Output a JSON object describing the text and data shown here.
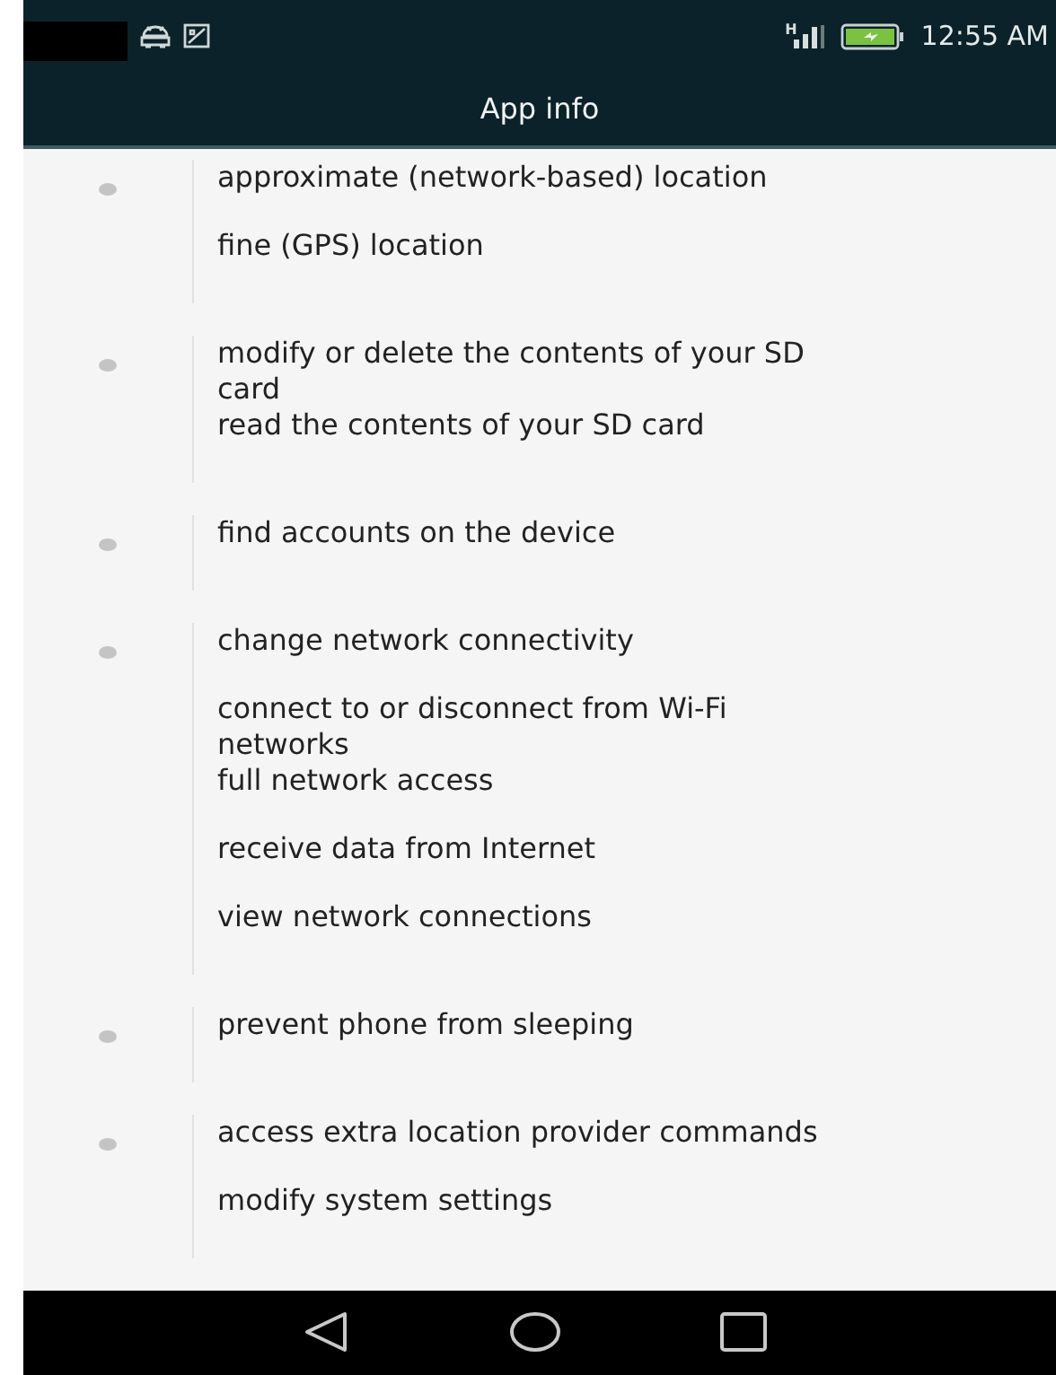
{
  "status_bar": {
    "time": "12:55 AM",
    "network_type": "H",
    "battery_charging": true
  },
  "title": "App info",
  "permission_groups": [
    {
      "items": [
        "approximate (network-based) location",
        "fine (GPS) location"
      ]
    },
    {
      "items": [
        "modify or delete the contents of your SD\ncard",
        "read the contents of your SD card"
      ]
    },
    {
      "items": [
        "find accounts on the device"
      ]
    },
    {
      "items": [
        "change network connectivity",
        "connect to or disconnect from Wi-Fi\nnetworks",
        "full network access",
        "receive data from Internet",
        "view network connections"
      ]
    },
    {
      "items": [
        "prevent phone from sleeping"
      ]
    },
    {
      "items": [
        "access extra location provider commands",
        "modify system settings"
      ]
    }
  ],
  "nav_buttons": [
    {
      "kind": "back"
    },
    {
      "kind": "home"
    },
    {
      "kind": "recents"
    }
  ]
}
